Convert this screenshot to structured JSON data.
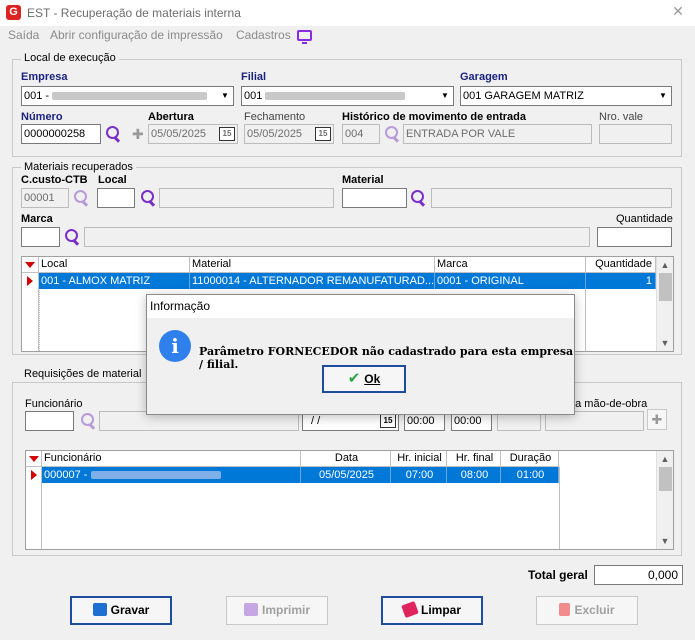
{
  "window": {
    "title": "EST - Recuperação de materiais interna",
    "close_glyph": "✕",
    "app_icon_letter": "G"
  },
  "menu": {
    "items": [
      "Saída",
      "Abrir configuração de impressão",
      "Cadastros"
    ]
  },
  "local_execucao": {
    "title": "Local de execução",
    "empresa_label": "Empresa",
    "empresa_value": "001 -",
    "filial_label": "Filial",
    "filial_value": "001",
    "garagem_label": "Garagem",
    "garagem_value": "001 GARAGEM MATRIZ",
    "numero_label": "Número",
    "numero_value": "0000000258",
    "abertura_label": "Abertura",
    "abertura_value": "05/05/2025",
    "fechamento_label": "Fechamento",
    "fechamento_value": "05/05/2025",
    "historico_label": "Histórico de movimento de entrada",
    "historico_code": "004",
    "historico_desc": "ENTRADA POR VALE",
    "nro_vale_label": "Nro. vale",
    "nro_vale_value": ""
  },
  "materiais": {
    "title": "Materiais recuperados",
    "ccusto_label": "C.custo-CTB",
    "ccusto_value": "00001",
    "local_label": "Local",
    "local_value": "",
    "material_label": "Material",
    "material_value": "",
    "marca_label": "Marca",
    "marca_value": "",
    "quantidade_label": "Quantidade",
    "quantidade_value": "",
    "columns": [
      "Local",
      "Material",
      "Marca",
      "Quantidade"
    ],
    "rows": [
      {
        "local": "001 - ALMOX MATRIZ",
        "material": "11000014 - ALTERNADOR REMANUFATURAD...",
        "marca": "0001 - ORIGINAL",
        "quantidade": "1"
      }
    ]
  },
  "requisicoes": {
    "title": "Requisições de material",
    "funcionario_label": "Funcionário",
    "mao_obra_label": "da mão-de-obra",
    "date_value": "/ /",
    "hr_inicial_value": "00:00",
    "hr_final_value": "00:00",
    "columns": [
      "Funcionário",
      "Data",
      "Hr. inicial",
      "Hr. final",
      "Duração"
    ],
    "rows": [
      {
        "funcionario": "000007 -",
        "data": "05/05/2025",
        "hr_inicial": "07:00",
        "hr_final": "08:00",
        "duracao": "01:00"
      }
    ]
  },
  "totals": {
    "label": "Total geral",
    "value": "0,000"
  },
  "buttons": {
    "gravar": "Gravar",
    "imprimir": "Imprimir",
    "limpar": "Limpar",
    "excluir": "Excluir"
  },
  "dialog": {
    "title": "Informação",
    "icon_glyph": "i",
    "message": "Parâmetro FORNECEDOR não cadastrado para esta empresa / filial.",
    "ok_label": "Ok"
  },
  "colors": {
    "selection": "#0078d7",
    "accent_purple": "#7b2fc9",
    "sort_red": "#d40000"
  }
}
